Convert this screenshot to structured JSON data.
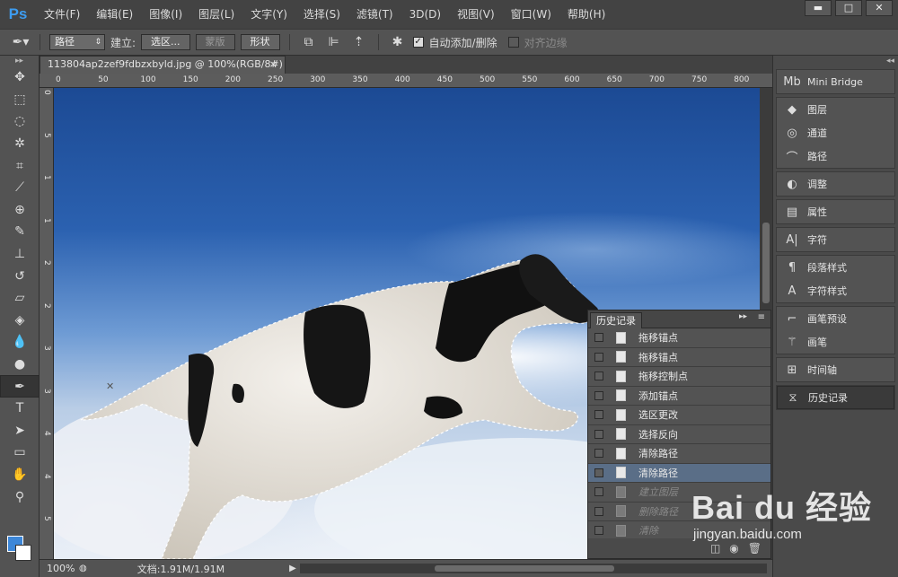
{
  "app": {
    "logo": "Ps"
  },
  "menu": [
    "文件(F)",
    "编辑(E)",
    "图像(I)",
    "图层(L)",
    "文字(Y)",
    "选择(S)",
    "滤镜(T)",
    "3D(D)",
    "视图(V)",
    "窗口(W)",
    "帮助(H)"
  ],
  "window_controls": {
    "minimize": "▬",
    "maximize": "□",
    "close": "✕"
  },
  "options": {
    "mode_select": "路径",
    "make_label": "建立:",
    "selection_btn": "选区...",
    "mask_btn": "蒙版",
    "shape_btn": "形状",
    "auto_add_label": "自动添加/删除",
    "auto_add_checked": true,
    "align_edges_label": "对齐边缘",
    "align_edges_checked": false
  },
  "tools": [
    {
      "icon": "move-icon",
      "glyph": "✥"
    },
    {
      "icon": "marquee-icon",
      "glyph": "⬚"
    },
    {
      "icon": "lasso-icon",
      "glyph": "◌"
    },
    {
      "icon": "magic-wand-icon",
      "glyph": "✲"
    },
    {
      "icon": "crop-icon",
      "glyph": "⌗"
    },
    {
      "icon": "eyedropper-icon",
      "glyph": "⟋"
    },
    {
      "icon": "healing-brush-icon",
      "glyph": "⊕"
    },
    {
      "icon": "brush-icon",
      "glyph": "✎"
    },
    {
      "icon": "clone-stamp-icon",
      "glyph": "⊥"
    },
    {
      "icon": "history-brush-icon",
      "glyph": "↺"
    },
    {
      "icon": "eraser-icon",
      "glyph": "▱"
    },
    {
      "icon": "paint-bucket-icon",
      "glyph": "◈"
    },
    {
      "icon": "blur-icon",
      "glyph": "💧"
    },
    {
      "icon": "dodge-icon",
      "glyph": "●"
    },
    {
      "icon": "pen-icon",
      "glyph": "✒"
    },
    {
      "icon": "type-icon",
      "glyph": "T"
    },
    {
      "icon": "path-selection-icon",
      "glyph": "➤"
    },
    {
      "icon": "rectangle-icon",
      "glyph": "▭"
    },
    {
      "icon": "hand-icon",
      "glyph": "✋"
    },
    {
      "icon": "zoom-icon",
      "glyph": "⚲"
    }
  ],
  "document": {
    "tab_title": "113804ap2zef9fdbzxbyld.jpg @ 100%(RGB/8#) *",
    "close": "×",
    "ruler_top": [
      "0",
      "50",
      "100",
      "150",
      "200",
      "250",
      "300",
      "350",
      "400",
      "450",
      "500",
      "550",
      "600",
      "650",
      "700",
      "750",
      "800"
    ],
    "ruler_left": [
      "0",
      "5",
      "1",
      "1",
      "2",
      "2",
      "3",
      "3",
      "4",
      "4",
      "5"
    ]
  },
  "status": {
    "zoom": "100%",
    "doc_info": "文档:1.91M/1.91M",
    "arrow": "▶"
  },
  "history": {
    "tab": "历史记录",
    "items": [
      {
        "label": "拖移锚点",
        "state": "normal"
      },
      {
        "label": "拖移锚点",
        "state": "normal"
      },
      {
        "label": "拖移控制点",
        "state": "normal"
      },
      {
        "label": "添加锚点",
        "state": "normal"
      },
      {
        "label": "选区更改",
        "state": "normal"
      },
      {
        "label": "选择反向",
        "state": "normal"
      },
      {
        "label": "清除路径",
        "state": "normal"
      },
      {
        "label": "清除路径",
        "state": "selected"
      },
      {
        "label": "建立图层",
        "state": "undone"
      },
      {
        "label": "删除路径",
        "state": "undone"
      },
      {
        "label": "清除",
        "state": "undone"
      }
    ]
  },
  "dock": [
    [
      {
        "label": "Mini Bridge",
        "icon": "mini-bridge-icon",
        "glyph": "Mb"
      }
    ],
    [
      {
        "label": "图层",
        "icon": "layers-icon",
        "glyph": "◆"
      },
      {
        "label": "通道",
        "icon": "channels-icon",
        "glyph": "◎"
      },
      {
        "label": "路径",
        "icon": "paths-icon",
        "glyph": "⌒"
      }
    ],
    [
      {
        "label": "调整",
        "icon": "adjustments-icon",
        "glyph": "◐"
      }
    ],
    [
      {
        "label": "属性",
        "icon": "properties-icon",
        "glyph": "▤"
      }
    ],
    [
      {
        "label": "字符",
        "icon": "character-icon",
        "glyph": "A|"
      }
    ],
    [
      {
        "label": "段落样式",
        "icon": "paragraph-styles-icon",
        "glyph": "¶"
      },
      {
        "label": "字符样式",
        "icon": "character-styles-icon",
        "glyph": "A"
      }
    ],
    [
      {
        "label": "画笔预设",
        "icon": "brush-presets-icon",
        "glyph": "⌐"
      },
      {
        "label": "画笔",
        "icon": "brush-panel-icon",
        "glyph": "⚚"
      }
    ],
    [
      {
        "label": "时间轴",
        "icon": "timeline-icon",
        "glyph": "⊞"
      }
    ],
    [
      {
        "label": "历史记录",
        "icon": "history-icon",
        "glyph": "⧖",
        "active": true
      }
    ]
  ],
  "watermark": {
    "logo": "Bai du 经验",
    "url": "jingyan.baidu.com"
  }
}
